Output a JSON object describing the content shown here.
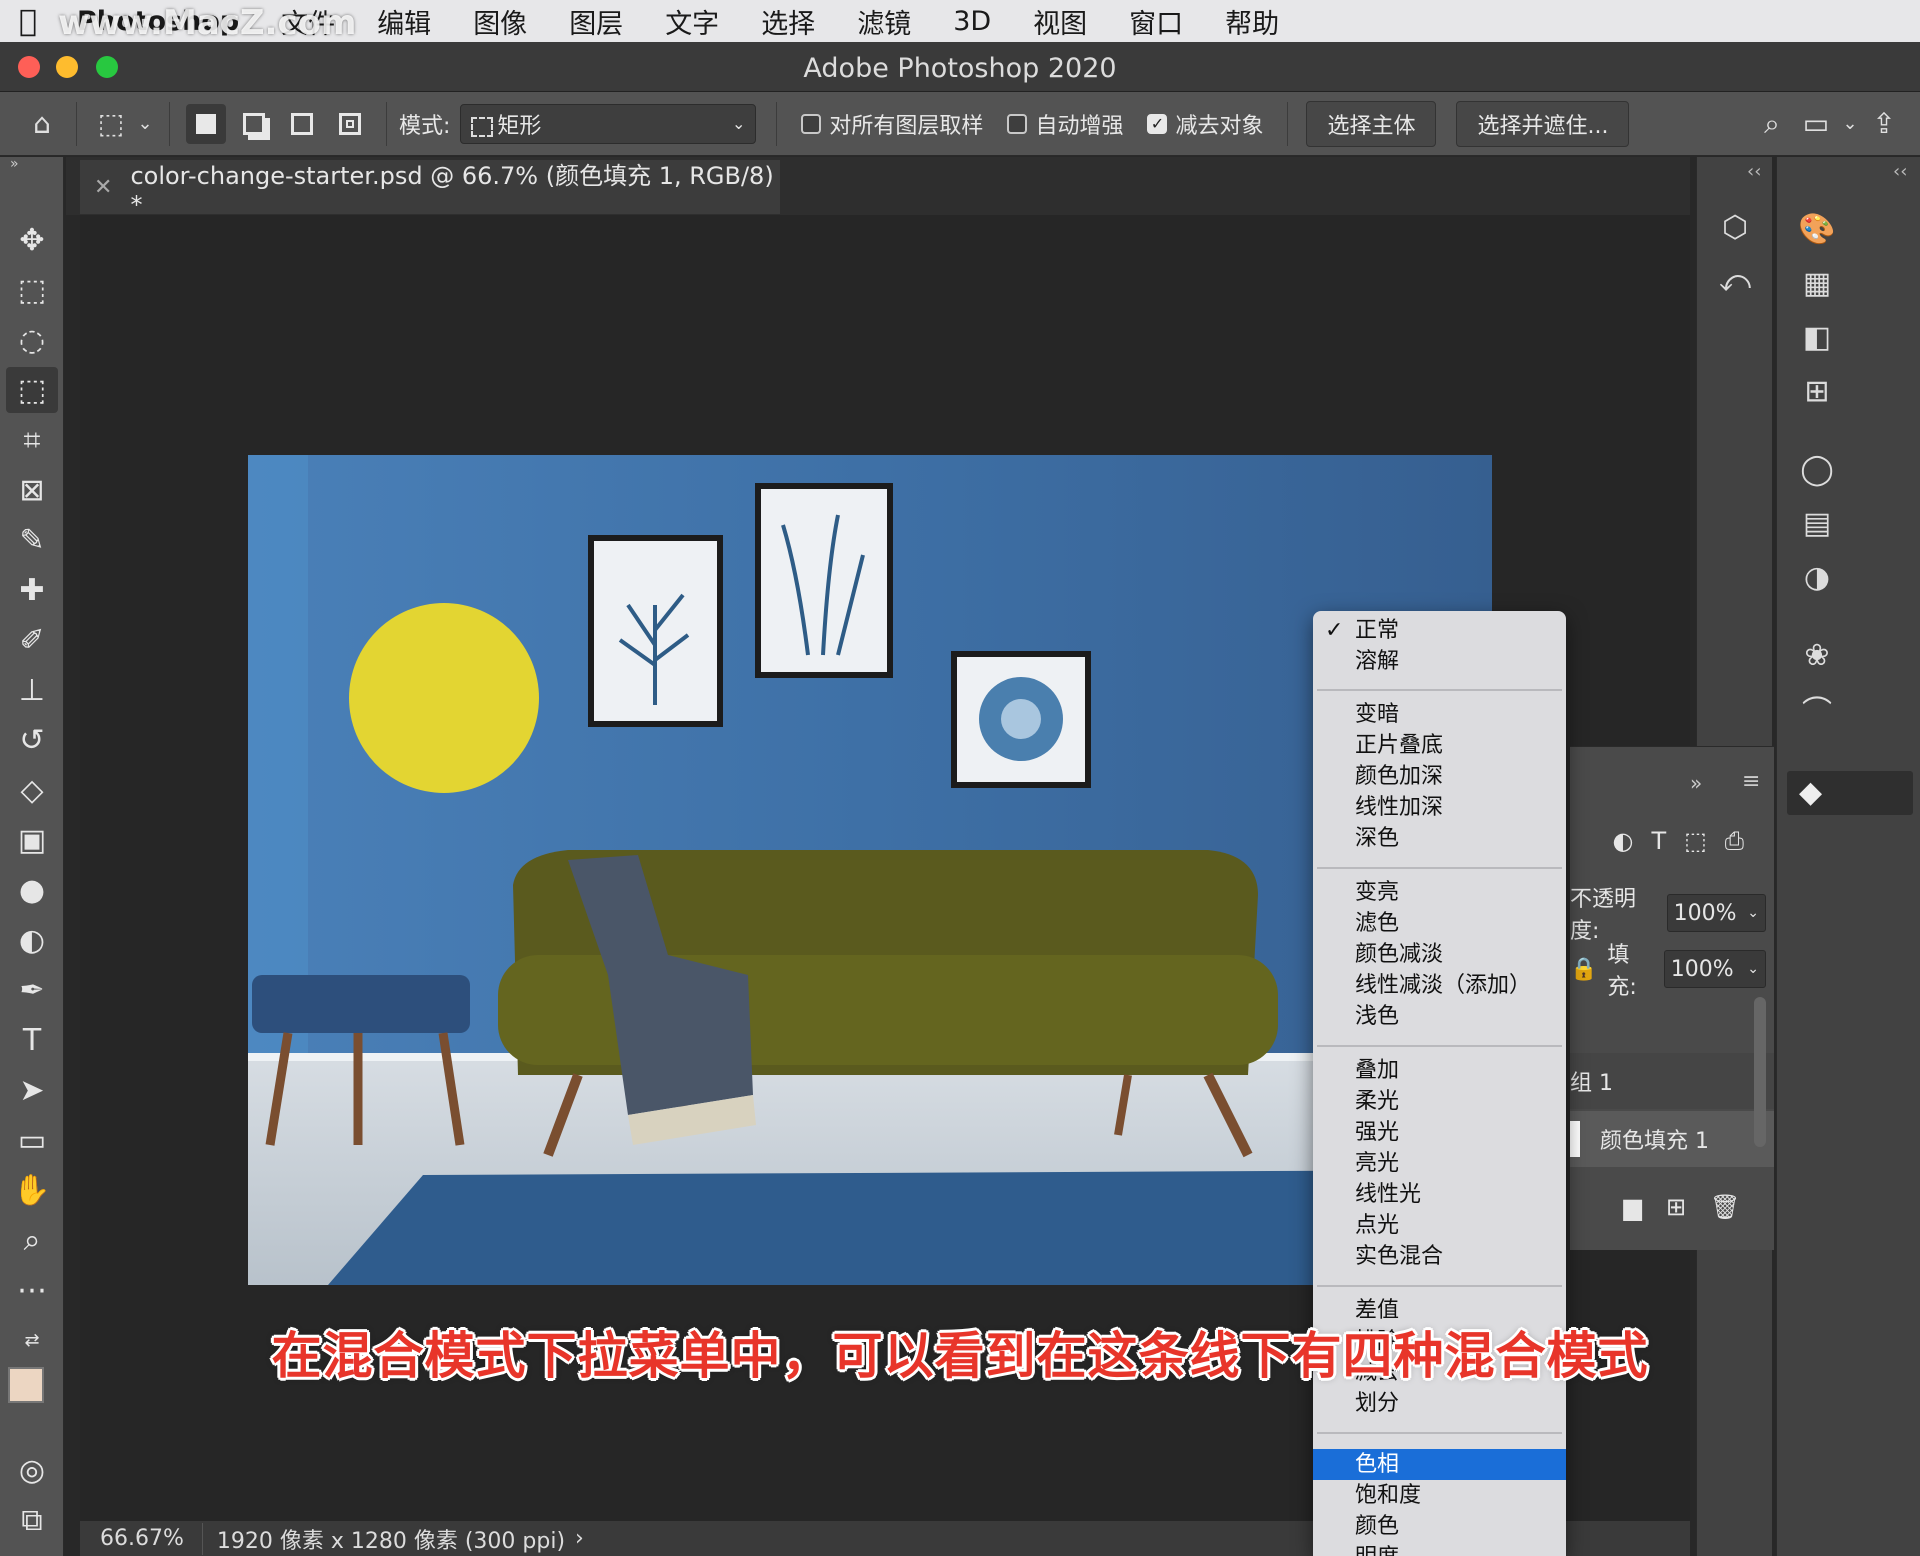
{
  "menubar": {
    "watermark": "www.MacZ.com",
    "items": [
      "Photoshop",
      "文件",
      "编辑",
      "图像",
      "图层",
      "文字",
      "选择",
      "滤镜",
      "3D",
      "视图",
      "窗口",
      "帮助"
    ]
  },
  "window": {
    "title": "Adobe Photoshop 2020"
  },
  "options": {
    "mode_label": "模式:",
    "mode_value": "矩形",
    "check_all_layers": "对所有图层取样",
    "check_auto_enhance": "自动增强",
    "check_subtract": "减去对象",
    "btn_select_subject": "选择主体",
    "btn_select_mask": "选择并遮住..."
  },
  "document": {
    "tab_title": "color-change-starter.psd @ 66.7% (颜色填充 1, RGB/8) *"
  },
  "layers": {
    "opacity_label": "不透明度:",
    "opacity_value": "100%",
    "fill_label": "填充:",
    "fill_value": "100%",
    "group_label": "组 1",
    "layer_name": "颜色填充 1"
  },
  "status": {
    "zoom": "66.67%",
    "info": "1920 像素 x 1280 像素 (300 ppi)"
  },
  "blend_menu": {
    "group1": [
      "正常",
      "溶解"
    ],
    "group2": [
      "变暗",
      "正片叠底",
      "颜色加深",
      "线性加深",
      "深色"
    ],
    "group3": [
      "变亮",
      "滤色",
      "颜色减淡",
      "线性减淡（添加）",
      "浅色"
    ],
    "group4": [
      "叠加",
      "柔光",
      "强光",
      "亮光",
      "线性光",
      "点光",
      "实色混合"
    ],
    "group5": [
      "差值",
      "排除",
      "减去",
      "划分"
    ],
    "group6": [
      "色相",
      "饱和度",
      "颜色",
      "明度"
    ],
    "checked": "正常",
    "highlighted": "色相"
  },
  "caption": "在混合模式下拉菜单中，可以看到在这条线下有四种混合模式",
  "colors": {
    "accent": "#1a6ed8",
    "caption": "#e8352a",
    "wall": "#3f73a8",
    "sun": "#e3d532",
    "sofa": "#5a5a1e"
  }
}
